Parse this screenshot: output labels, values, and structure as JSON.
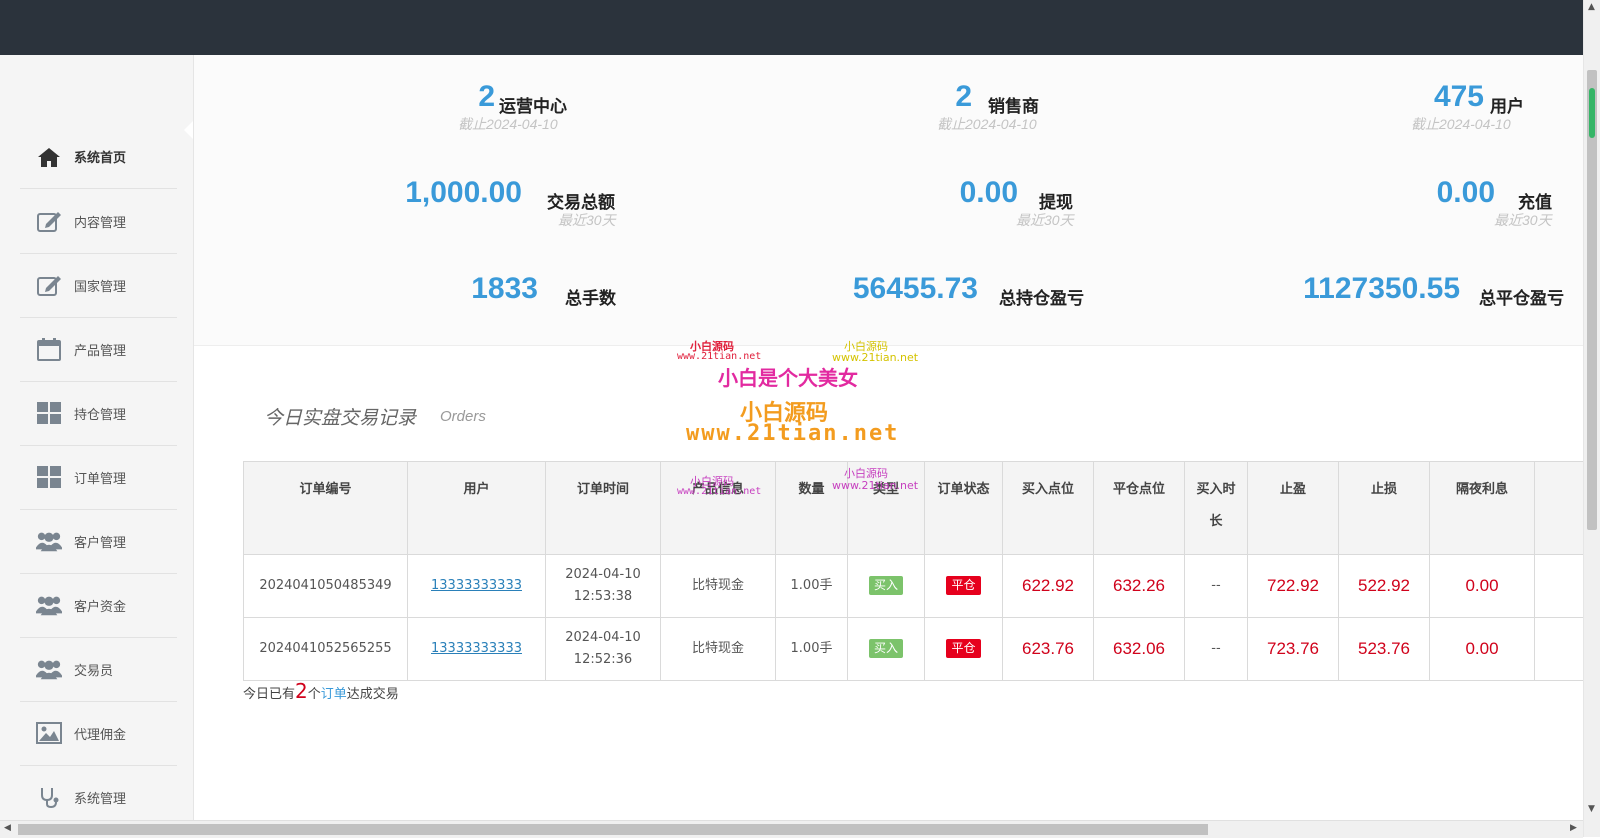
{
  "sidebar": {
    "items": [
      {
        "label": "系统首页",
        "icon": "home-icon"
      },
      {
        "label": "内容管理",
        "icon": "edit-icon"
      },
      {
        "label": "国家管理",
        "icon": "edit-icon"
      },
      {
        "label": "产品管理",
        "icon": "calendar-icon"
      },
      {
        "label": "持仓管理",
        "icon": "grid-icon"
      },
      {
        "label": "订单管理",
        "icon": "grid-icon"
      },
      {
        "label": "客户管理",
        "icon": "users-icon"
      },
      {
        "label": "客户资金",
        "icon": "users-icon"
      },
      {
        "label": "交易员",
        "icon": "users-icon"
      },
      {
        "label": "代理佣金",
        "icon": "image-icon"
      },
      {
        "label": "系统管理",
        "icon": "stethoscope-icon"
      }
    ]
  },
  "stats": {
    "ops_center": {
      "value": "2",
      "label": "运营中心",
      "sub": "截止2024-04-10"
    },
    "dealers": {
      "value": "2",
      "label": "销售商",
      "sub": "截止2024-04-10"
    },
    "users": {
      "value": "475",
      "label": "用户",
      "sub": "截止2024-04-10"
    },
    "trade_total": {
      "value": "1,000.00",
      "label": "交易总额",
      "sub": "最近30天"
    },
    "withdraw": {
      "value": "0.00",
      "label": "提现",
      "sub": "最近30天"
    },
    "recharge": {
      "value": "0.00",
      "label": "充值",
      "sub": "最近30天"
    },
    "total_lots": {
      "value": "1833",
      "label": "总手数"
    },
    "hold_pl": {
      "value": "56455.73",
      "label": "总持仓盈亏"
    },
    "close_pl": {
      "value": "1127350.55",
      "label": "总平仓盈亏"
    }
  },
  "orders": {
    "title": "今日实盘交易记录",
    "subtitle": "Orders",
    "columns": [
      "订单编号",
      "用户",
      "订单时间",
      "产品信息",
      "数量",
      "类型",
      "订单状态",
      "买入点位",
      "平仓点位",
      "买入时长",
      "止盈",
      "止损",
      "隔夜利息"
    ],
    "rows": [
      {
        "id": "2024041050485349",
        "user": "13333333333",
        "date": "2024-04-10",
        "time": "12:53:38",
        "product": "比特现金",
        "qty": "1.00手",
        "type": "买入",
        "status": "平仓",
        "buy": "622.92",
        "close": "632.26",
        "duration": "--",
        "tp": "722.92",
        "sl": "522.92",
        "interest": "0.00"
      },
      {
        "id": "2024041052565255",
        "user": "13333333333",
        "date": "2024-04-10",
        "time": "12:52:36",
        "product": "比特现金",
        "qty": "1.00手",
        "type": "买入",
        "status": "平仓",
        "buy": "623.76",
        "close": "632.06",
        "duration": "--",
        "tp": "723.76",
        "sl": "523.76",
        "interest": "0.00"
      }
    ]
  },
  "footer": {
    "prefix": "今日已有",
    "count": "2",
    "mid": "个",
    "link": "订单",
    "suffix": "达成交易"
  },
  "watermarks": {
    "w1": "小白源码",
    "w2": "www.21tian.net",
    "w3": "小白是个大美女"
  },
  "colors": {
    "accent": "#3a9ad9",
    "topbar": "#2b333c",
    "red": "#d0021b",
    "buy_tag": "#7cc36b",
    "close_tag": "#e6001d"
  }
}
